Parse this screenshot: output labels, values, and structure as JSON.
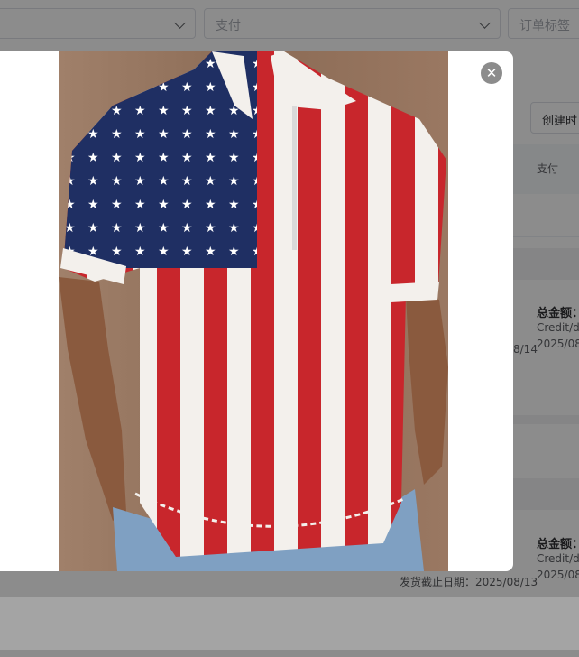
{
  "filters": {
    "payment_placeholder": "支付",
    "order_tag_placeholder": "订单标签"
  },
  "toolbar": {
    "created_time_label": "创建时"
  },
  "table": {
    "payment_column": "支付"
  },
  "orders": [
    {
      "total_label": "总金额：",
      "payment_method": "Credit/de",
      "date": "2025/08",
      "deadline_fragment": "8/14"
    },
    {
      "total_label": "总金额：",
      "payment_method": "Credit/de",
      "date": "2025/08",
      "ship_deadline": "发货截止日期：2025/08/13"
    }
  ],
  "modal": {
    "close_icon": "close-icon",
    "image_subject": "american-flag-zip-polo-shirt"
  },
  "colors": {
    "flag_red": "#c8262c",
    "flag_blue": "#1f2f63",
    "shorts_blue": "#7fa0c2",
    "backdrop_brown": "#8b6b55"
  }
}
